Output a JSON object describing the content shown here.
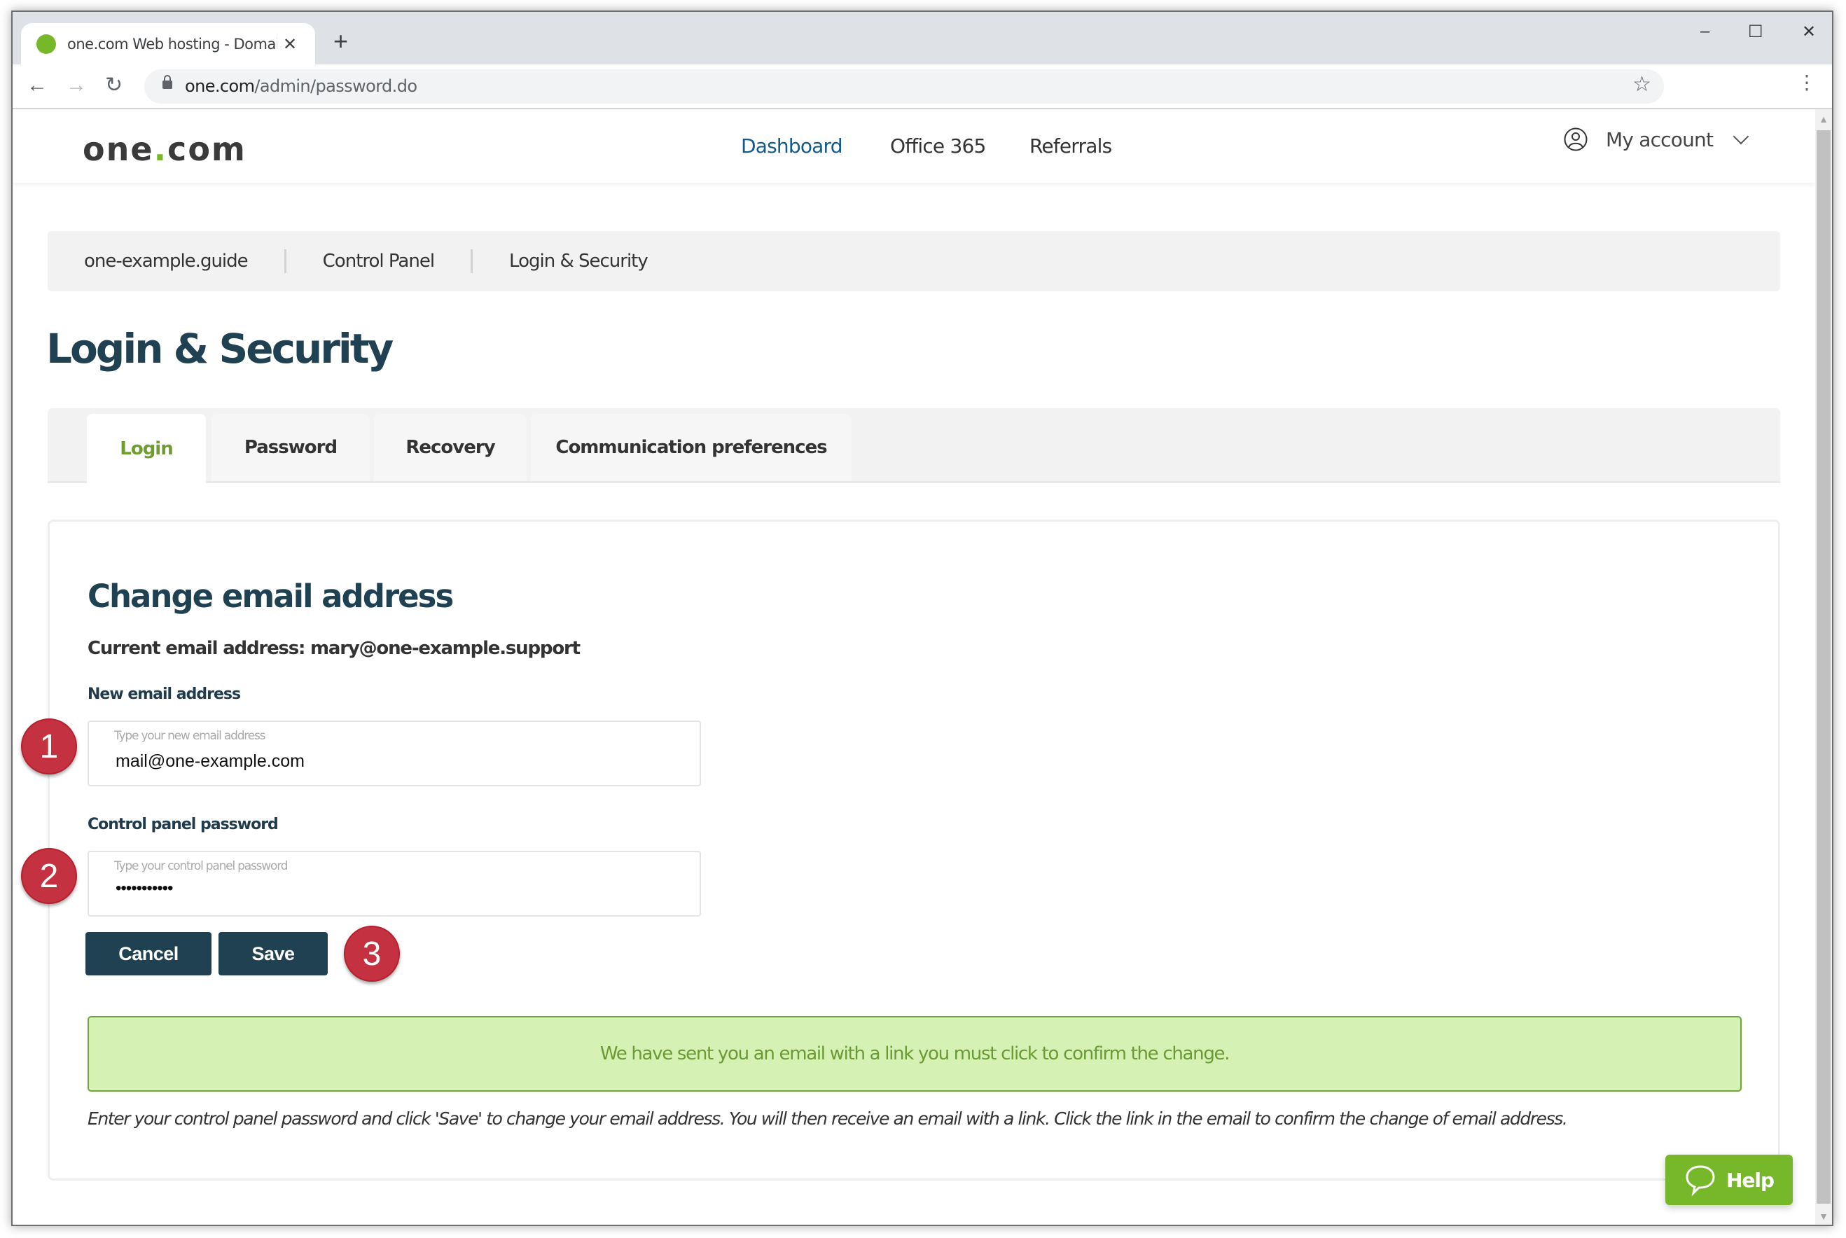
{
  "browser": {
    "tab_title": "one.com Web hosting  -  Domain",
    "new_tab": "+",
    "tab_close": "✕",
    "url_host": "one.com",
    "url_path": "/admin/password.do",
    "back": "←",
    "forward": "→",
    "reload": "↻",
    "star": "☆",
    "menu": "⋮",
    "minimize": "–",
    "maximize": "☐",
    "close": "✕"
  },
  "site": {
    "logo_one": "one",
    "logo_dot": ".",
    "logo_com": "com",
    "nav": [
      {
        "label": "Dashboard",
        "active": true
      },
      {
        "label": "Office 365",
        "active": false
      },
      {
        "label": "Referrals",
        "active": false
      }
    ],
    "account_label": "My account"
  },
  "breadcrumb": [
    "one-example.guide",
    "Control Panel",
    "Login & Security"
  ],
  "page_title": "Login & Security",
  "tabs": [
    {
      "label": "Login",
      "active": true
    },
    {
      "label": "Password",
      "active": false
    },
    {
      "label": "Recovery",
      "active": false
    },
    {
      "label": "Communication preferences",
      "active": false
    }
  ],
  "form": {
    "title": "Change email address",
    "current_email": "Current email address: mary@one-example.support",
    "new_email_label": "New email address",
    "new_email_placeholder": "Type your new email address",
    "new_email_value": "mail@one-example.com",
    "password_label": "Control panel password",
    "password_placeholder": "Type your control panel password",
    "password_value": "•••••••••••",
    "cancel_label": "Cancel",
    "save_label": "Save",
    "success_message": "We have sent you an email with a link you must click to confirm the change.",
    "hint": "Enter your control panel password and click 'Save' to change your email address. You will then receive an email with a link. Click the link in the email to confirm the change of email address."
  },
  "markers": [
    "1",
    "2",
    "3"
  ],
  "help_label": "Help",
  "colors": {
    "brand_green": "#77b82a",
    "navy": "#1f4152",
    "marker_red": "#c43241",
    "success_bg": "#d5f2b4",
    "nav_active": "#105a8c"
  }
}
